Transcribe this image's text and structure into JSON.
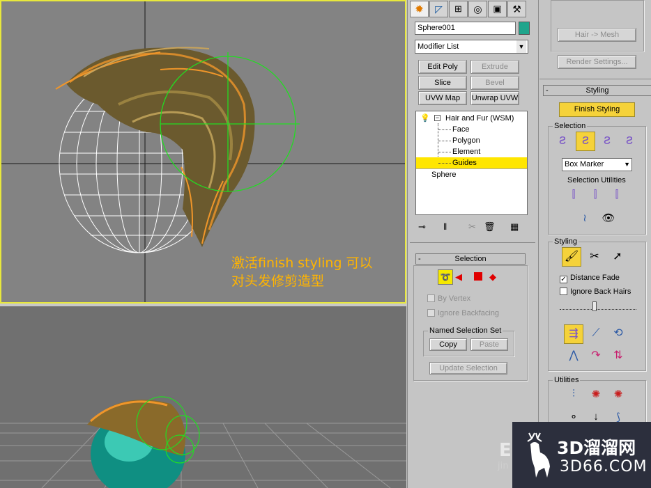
{
  "viewport_top": {
    "annotation_line1": "激活finish styling 可以",
    "annotation_line2": "对头发修剪造型"
  },
  "command_panel": {
    "tabs": [
      "create-icon",
      "modify-icon",
      "hierarchy-icon",
      "motion-icon",
      "display-icon",
      "utilities-icon"
    ],
    "object_name": "Sphere001",
    "object_color": "#1fa58c",
    "modifier_list": "Modifier List",
    "buttons": {
      "edit_poly": "Edit Poly",
      "extrude": "Extrude",
      "slice": "Slice",
      "bevel": "Bevel",
      "uvw_map": "UVW Map",
      "unwrap_uvw": "Unwrap UVW"
    },
    "stack": {
      "modifier": "Hair and Fur (WSM)",
      "subobjects": [
        "Face",
        "Polygon",
        "Element",
        "Guides"
      ],
      "selected": "Guides",
      "base": "Sphere"
    },
    "selection_rollout": {
      "title": "Selection",
      "by_vertex": "By Vertex",
      "ignore_backfacing": "Ignore Backfacing",
      "named_selection_set": "Named Selection Set",
      "copy": "Copy",
      "paste": "Paste",
      "update_selection": "Update Selection"
    }
  },
  "styling_panel": {
    "hair_mesh": "Hair -> Mesh",
    "render_settings": "Render Settings...",
    "rollout_title": "Styling",
    "finish_styling": "Finish Styling",
    "selection_group": "Selection",
    "box_marker": "Box Marker",
    "selection_utilities": "Selection Utilities",
    "styling_group": "Styling",
    "distance_fade": "Distance Fade",
    "ignore_back_hairs": "Ignore Back Hairs",
    "distance_fade_checked": true,
    "ignore_back_hairs_checked": false,
    "utilities_group": "Utilities"
  },
  "watermark": {
    "brand": "3D溜溜网",
    "domain": "3D66.COM",
    "left_partial": "jin"
  },
  "colors": {
    "accent_yellow": "#f5d23a",
    "hair_orange": "#f0962a",
    "guide_green": "#22dd22",
    "annotation": "#ffb400"
  }
}
